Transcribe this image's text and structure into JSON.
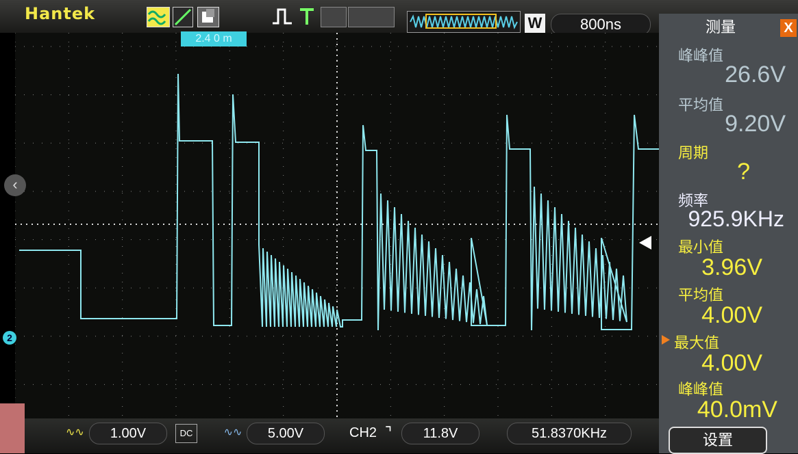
{
  "brand": "Hantek",
  "timebase": "800ns",
  "mode_button": "W",
  "trigger_time_marker": "2.4 0 m",
  "measure_panel": {
    "title": "测量",
    "close_label": "X",
    "items": [
      {
        "label": "峰峰值",
        "value": "26.6V",
        "style": "dim"
      },
      {
        "label": "平均值",
        "value": "9.20V",
        "style": "dim"
      },
      {
        "label": "周期",
        "value": "?",
        "style": "yel"
      },
      {
        "label": "频率",
        "value": "925.9KHz",
        "style": "white"
      },
      {
        "label": "最小值",
        "value": "3.96V",
        "style": "yel"
      },
      {
        "label": "平均值",
        "value": "4.00V",
        "style": "yel"
      },
      {
        "label": "最大值",
        "value": "4.00V",
        "style": "yel",
        "selected": true
      },
      {
        "label": "峰峰值",
        "value": "40.0mV",
        "style": "yel"
      }
    ],
    "setup_label": "设置"
  },
  "bottom": {
    "ch1_volts": "1.00V",
    "coupling": "DC",
    "ch2_volts": "5.00V",
    "trigger_source": "CH2",
    "trigger_level": "11.8V",
    "frequency": "51.8370KHz"
  },
  "channel_marker": "2",
  "colors": {
    "trace": "#8fe8f0",
    "accent": "#f2e84a",
    "panel": "#4a4e52",
    "grid": "#bbbbbb"
  },
  "icons": [
    "wave-icon",
    "ramp-icon",
    "grid-icon",
    "trigger-edge-icon",
    "trigger-T-icon",
    "waveform-overview-icon",
    "close-icon",
    "left-arrow-icon"
  ]
}
